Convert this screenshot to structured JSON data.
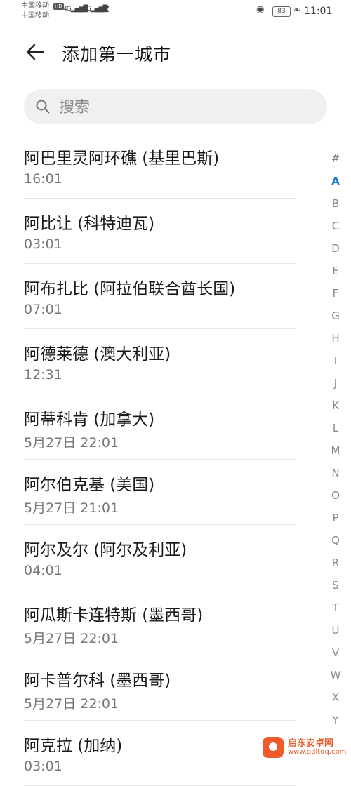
{
  "status_bar": {
    "carrier1": "中国移动",
    "carrier2": "中国移动",
    "hd_badge": "HD",
    "signal1": "4G",
    "signal2": "4G",
    "battery": "83",
    "time": "11:01"
  },
  "header": {
    "title": "添加第一城市"
  },
  "search": {
    "placeholder": "搜索"
  },
  "cities": [
    {
      "name": "阿巴里灵阿环礁 (基里巴斯)",
      "time": "16:01"
    },
    {
      "name": "阿比让 (科特迪瓦)",
      "time": "03:01"
    },
    {
      "name": "阿布扎比 (阿拉伯联合酋长国)",
      "time": "07:01"
    },
    {
      "name": "阿德莱德 (澳大利亚)",
      "time": "12:31"
    },
    {
      "name": "阿蒂科肯 (加拿大)",
      "time": "5月27日 22:01"
    },
    {
      "name": "阿尔伯克基 (美国)",
      "time": "5月27日 21:01"
    },
    {
      "name": "阿尔及尔 (阿尔及利亚)",
      "time": "04:01"
    },
    {
      "name": "阿瓜斯卡连特斯 (墨西哥)",
      "time": "5月27日 22:01"
    },
    {
      "name": "阿卡普尔科 (墨西哥)",
      "time": "5月27日 22:01"
    },
    {
      "name": "阿克拉 (加纳)",
      "time": "03:01"
    }
  ],
  "index": {
    "letters": [
      "#",
      "A",
      "B",
      "C",
      "D",
      "E",
      "F",
      "G",
      "H",
      "I",
      "J",
      "K",
      "L",
      "M",
      "N",
      "O",
      "P",
      "Q",
      "R",
      "S",
      "T",
      "U",
      "V",
      "W",
      "X",
      "Y"
    ],
    "active": "A",
    "active_color": "#1e78d8"
  },
  "watermark": {
    "name": "启东安卓网",
    "url": "www.qdltdq.com"
  }
}
